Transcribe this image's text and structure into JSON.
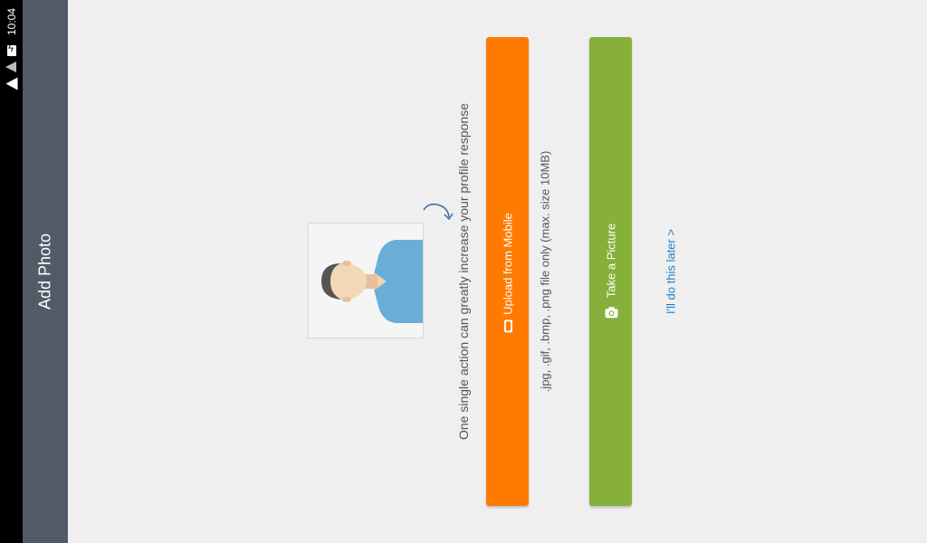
{
  "status_bar": {
    "time": "10:04",
    "icons": [
      "battery-charging-icon",
      "signal-icon",
      "wifi-icon"
    ]
  },
  "app_bar": {
    "title": "Add Photo"
  },
  "main": {
    "avatar_icon": "default-profile-avatar-icon",
    "tagline": "One single action can greatly increase your profile response",
    "upload_button": {
      "label": "Upload from Mobile",
      "icon": "mobile-phone-icon",
      "color": "#ff7a00"
    },
    "file_hint": ".jpg, .gif, .bmp, .png file only (max. size 10MB)",
    "take_picture_button": {
      "label": "Take a Picture",
      "icon": "camera-icon",
      "color": "#86b03a"
    },
    "skip_link": "I'll do this later >"
  }
}
